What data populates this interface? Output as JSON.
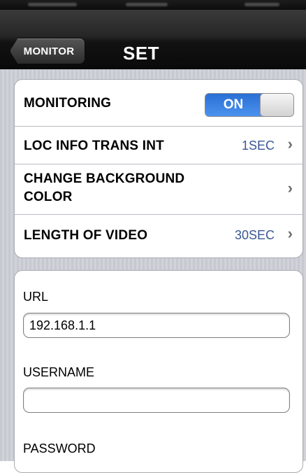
{
  "nav": {
    "back_label": "MONITOR",
    "title": "SET"
  },
  "settings": {
    "monitoring": {
      "label": "MONITORING",
      "switch_state": "ON"
    },
    "loc_info": {
      "label": "LOC INFO TRANS INT",
      "value": "1SEC"
    },
    "background": {
      "label_line1": "CHANGE BACKGROUND",
      "label_line2": "COLOR"
    },
    "video_length": {
      "label": "LENGTH OF VIDEO",
      "value": "30SEC"
    },
    "chevron": "›"
  },
  "form": {
    "url": {
      "label": "URL",
      "value": "192.168.1.1"
    },
    "username": {
      "label": "USERNAME",
      "value": ""
    },
    "password": {
      "label": "PASSWORD"
    }
  },
  "colors": {
    "accent": "#3a5795",
    "switch_on": "#2a6fd4"
  }
}
